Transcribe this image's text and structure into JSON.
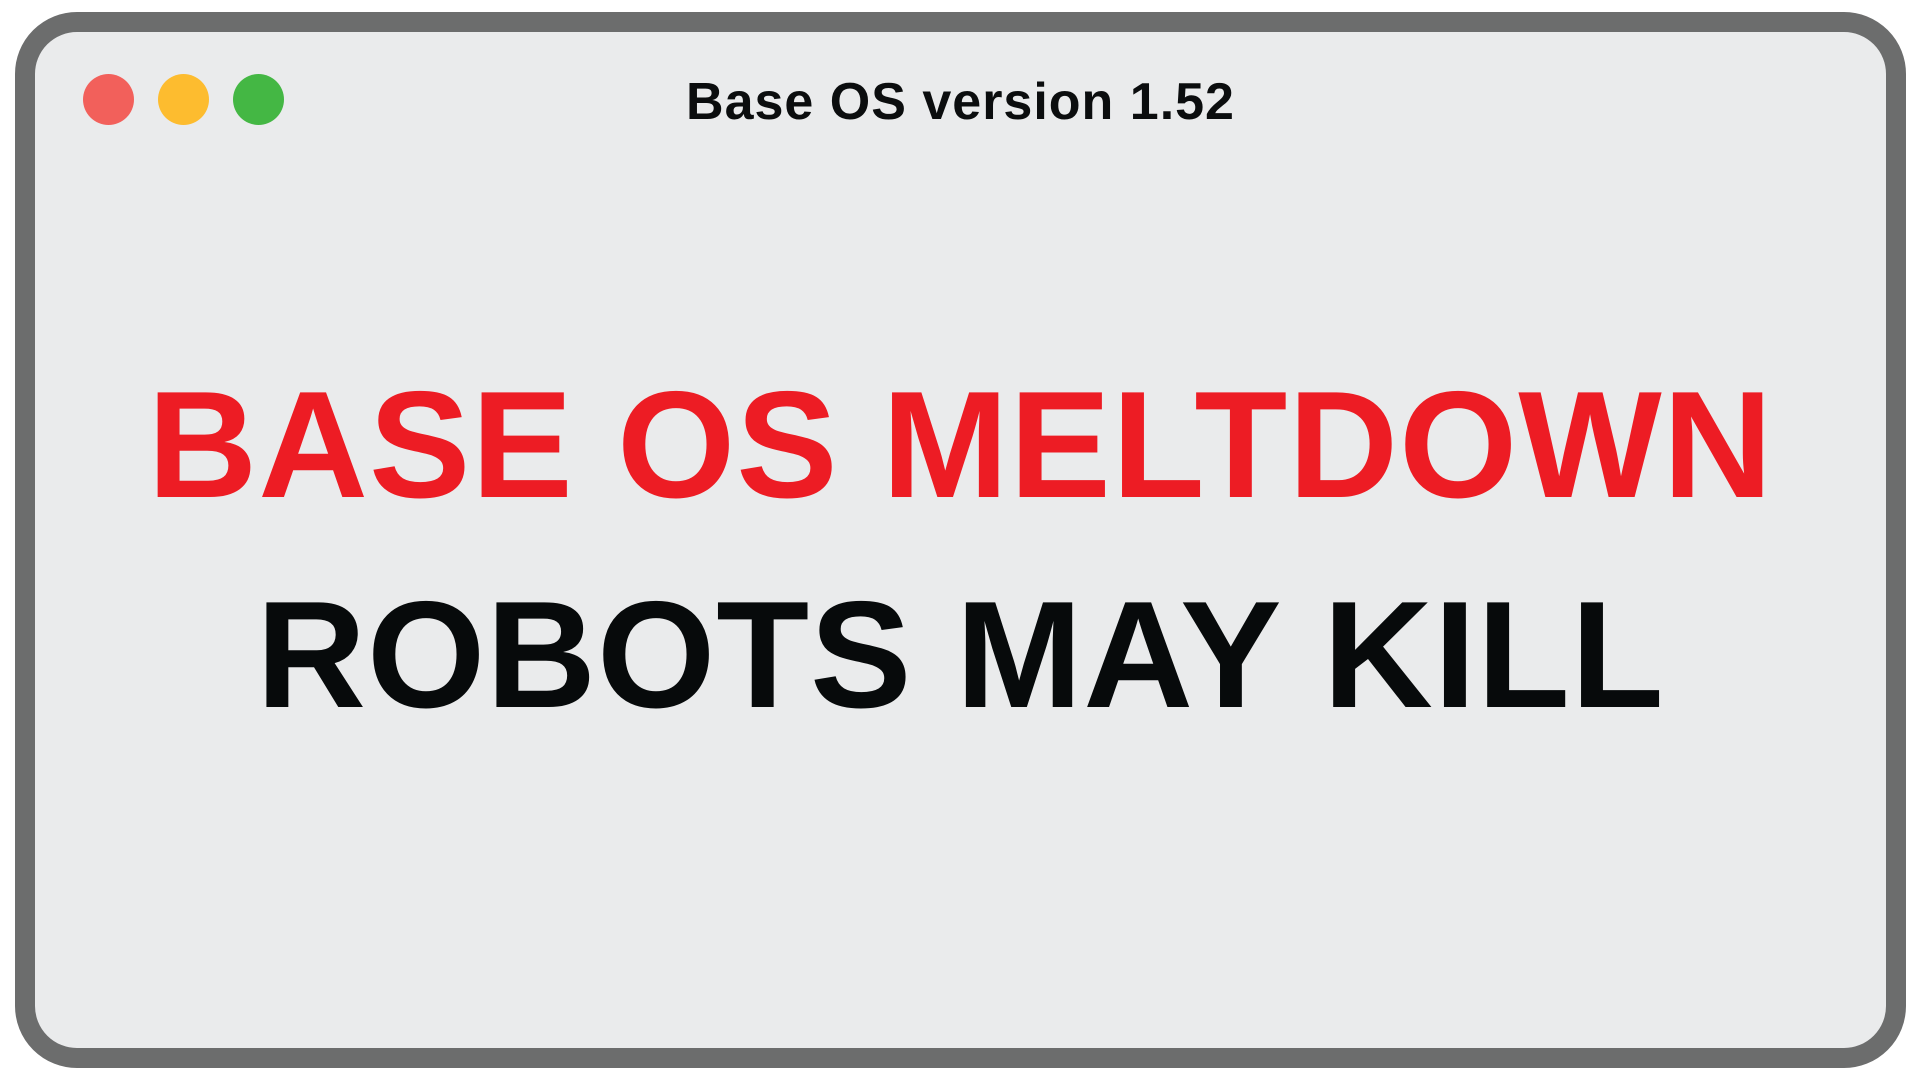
{
  "window": {
    "title": "Base OS version 1.52",
    "controls": [
      {
        "name": "close",
        "color": "#f2605b"
      },
      {
        "name": "minimize",
        "color": "#fdbc2f"
      },
      {
        "name": "maximize",
        "color": "#44b744"
      }
    ]
  },
  "message": {
    "headline": "BASE OS MELTDOWN",
    "subheadline": "ROBOTS MAY KILL",
    "headline_color": "#ed1c24",
    "subheadline_color": "#070a0b"
  },
  "colors": {
    "window_background": "#eaebec",
    "window_border": "#6c6d6d"
  }
}
